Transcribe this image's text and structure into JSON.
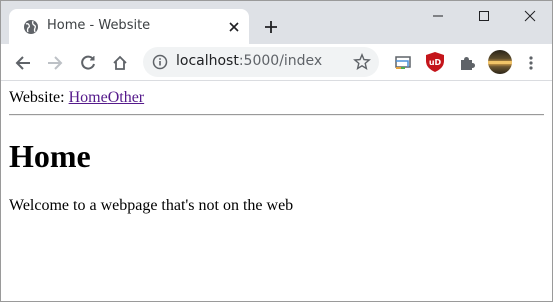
{
  "browser": {
    "tab": {
      "title": "Home - Website",
      "favicon": "globe-icon",
      "close_icon": "close-icon"
    },
    "new_tab_icon": "plus-icon",
    "window_controls": [
      "minimize-icon",
      "maximize-icon",
      "close-icon"
    ],
    "toolbar": {
      "back_icon": "arrow-left-icon",
      "forward_icon": "arrow-right-icon",
      "reload_icon": "reload-icon",
      "home_icon": "home-icon",
      "address": {
        "host": "localhost",
        "path": ":5000/index",
        "info_icon": "info-icon",
        "bookmark_icon": "star-icon"
      },
      "extensions": [
        "cast-icon",
        "ublock-origin-icon",
        "puzzle-icon"
      ],
      "ublock_label": "uD",
      "profile": "avatar",
      "menu_icon": "kebab-menu-icon"
    }
  },
  "page": {
    "nav": {
      "prefix": "Website:",
      "links": [
        "Home",
        "Other"
      ]
    },
    "heading": "Home",
    "paragraph": "Welcome to a webpage that's not on the web"
  },
  "colors": {
    "tabstrip": "#dee1e6",
    "omnibox": "#f1f3f4",
    "link_visited": "#551a8b",
    "ublock_red": "#c4151b"
  }
}
